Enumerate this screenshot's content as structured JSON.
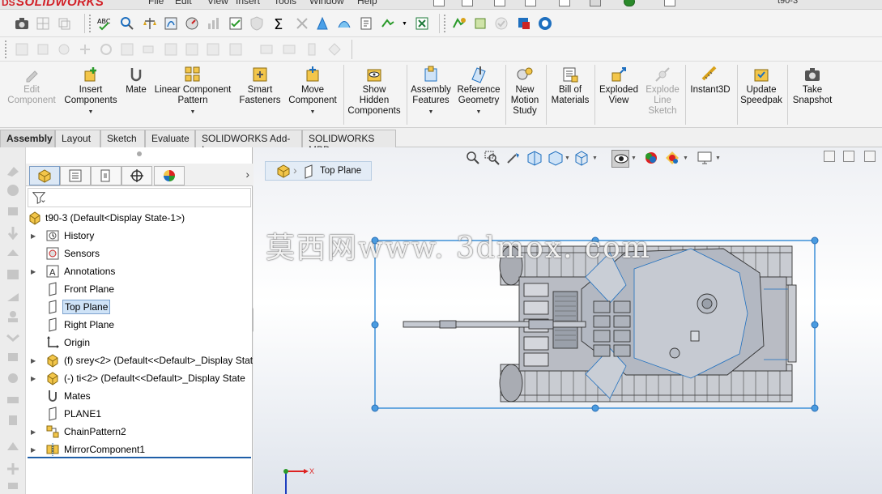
{
  "app": {
    "logo_text": "SOLIDWORKS",
    "menu": [
      "File",
      "Edit",
      "View",
      "Insert",
      "Tools",
      "Window",
      "Help"
    ],
    "document_name": "t90-3"
  },
  "command_manager": {
    "commands": [
      {
        "label": "Edit\nComponent",
        "icon": "edit-component-icon",
        "disabled": true
      },
      {
        "label": "Insert\nComponents",
        "icon": "insert-components-icon",
        "disabled": false,
        "dropdown": true
      },
      {
        "label": "Mate",
        "icon": "mate-icon",
        "disabled": false
      },
      {
        "label": "Linear Component\nPattern",
        "icon": "linear-pattern-icon",
        "disabled": false,
        "dropdown": true
      },
      {
        "label": "Smart\nFasteners",
        "icon": "smart-fasteners-icon",
        "disabled": false
      },
      {
        "label": "Move\nComponent",
        "icon": "move-component-icon",
        "disabled": false,
        "dropdown": true
      },
      {
        "label": "Show\nHidden\nComponents",
        "icon": "show-hidden-icon",
        "disabled": false
      },
      {
        "label": "Assembly\nFeatures",
        "icon": "assembly-features-icon",
        "disabled": false,
        "dropdown": true
      },
      {
        "label": "Reference\nGeometry",
        "icon": "reference-geometry-icon",
        "disabled": false,
        "dropdown": true
      },
      {
        "label": "New\nMotion\nStudy",
        "icon": "motion-study-icon",
        "disabled": false
      },
      {
        "label": "Bill of\nMaterials",
        "icon": "bom-icon",
        "disabled": false
      },
      {
        "label": "Exploded\nView",
        "icon": "exploded-view-icon",
        "disabled": false
      },
      {
        "label": "Explode\nLine\nSketch",
        "icon": "explode-line-icon",
        "disabled": true
      },
      {
        "label": "Instant3D",
        "icon": "instant3d-icon",
        "disabled": false
      },
      {
        "label": "Update\nSpeedpak",
        "icon": "speedpak-icon",
        "disabled": false
      },
      {
        "label": "Take\nSnapshot",
        "icon": "snapshot-icon",
        "disabled": false
      }
    ]
  },
  "tabs": [
    "Assembly",
    "Layout",
    "Sketch",
    "Evaluate",
    "SOLIDWORKS Add-Ins",
    "SOLIDWORKS MBD"
  ],
  "active_tab": "Assembly",
  "feature_tree": {
    "root": "t90-3  (Default<Display State-1>)",
    "items": [
      {
        "label": "History",
        "icon": "history-icon",
        "expandable": true,
        "selected": false
      },
      {
        "label": "Sensors",
        "icon": "sensors-icon",
        "expandable": false,
        "selected": false
      },
      {
        "label": "Annotations",
        "icon": "annotations-icon",
        "expandable": true,
        "selected": false
      },
      {
        "label": "Front Plane",
        "icon": "plane-icon",
        "expandable": false,
        "selected": false
      },
      {
        "label": "Top Plane",
        "icon": "plane-icon",
        "expandable": false,
        "selected": true
      },
      {
        "label": "Right Plane",
        "icon": "plane-icon",
        "expandable": false,
        "selected": false
      },
      {
        "label": "Origin",
        "icon": "origin-icon",
        "expandable": false,
        "selected": false
      },
      {
        "label": "(f) srey<2> (Default<<Default>_Display Stat",
        "icon": "part-icon",
        "expandable": true,
        "selected": false
      },
      {
        "label": "(-) ti<2> (Default<<Default>_Display State",
        "icon": "part-icon",
        "expandable": true,
        "selected": false
      },
      {
        "label": "Mates",
        "icon": "mates-icon",
        "expandable": false,
        "selected": false
      },
      {
        "label": "PLANE1",
        "icon": "plane-icon",
        "expandable": false,
        "selected": false
      },
      {
        "label": "ChainPattern2",
        "icon": "chain-pattern-icon",
        "expandable": true,
        "selected": false
      },
      {
        "label": "MirrorComponent1",
        "icon": "mirror-component-icon",
        "expandable": true,
        "selected": false
      }
    ]
  },
  "graphics": {
    "breadcrumb_label": "Top Plane",
    "watermark": "莫西网www. 3dmox. com",
    "triad_x_label": "X",
    "selection_color": "#3c8fd8"
  }
}
